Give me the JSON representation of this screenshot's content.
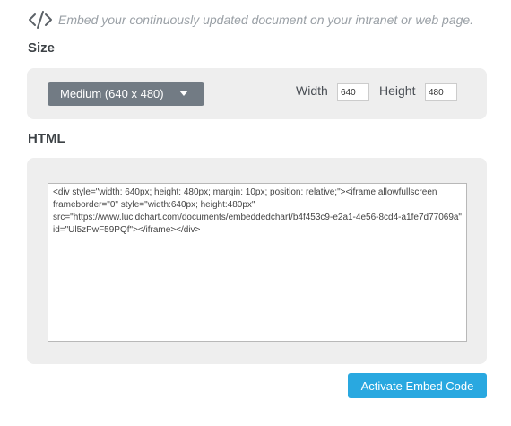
{
  "intro": {
    "icon": "code-icon",
    "text": "Embed your continuously updated document on your intranet or web page."
  },
  "size": {
    "title": "Size",
    "dropdown_value": "Medium (640 x 480)",
    "width_label": "Width",
    "width_value": "640",
    "height_label": "Height",
    "height_value": "480"
  },
  "html": {
    "title": "HTML",
    "code": "<div style=\"width: 640px; height: 480px; margin: 10px; position: relative;\"><iframe allowfullscreen frameborder=\"0\" style=\"width:640px; height:480px\" src=\"https://www.lucidchart.com/documents/embeddedchart/b4f453c9-e2a1-4e56-8cd4-a1fe7d77069a\" id=\"Ul5zPwF59PQf\"></iframe></div>"
  },
  "actions": {
    "activate_label": "Activate Embed Code"
  },
  "colors": {
    "panel_bg": "#eeeeee",
    "dropdown_bg": "#727b84",
    "button_bg": "#29a8e0"
  }
}
